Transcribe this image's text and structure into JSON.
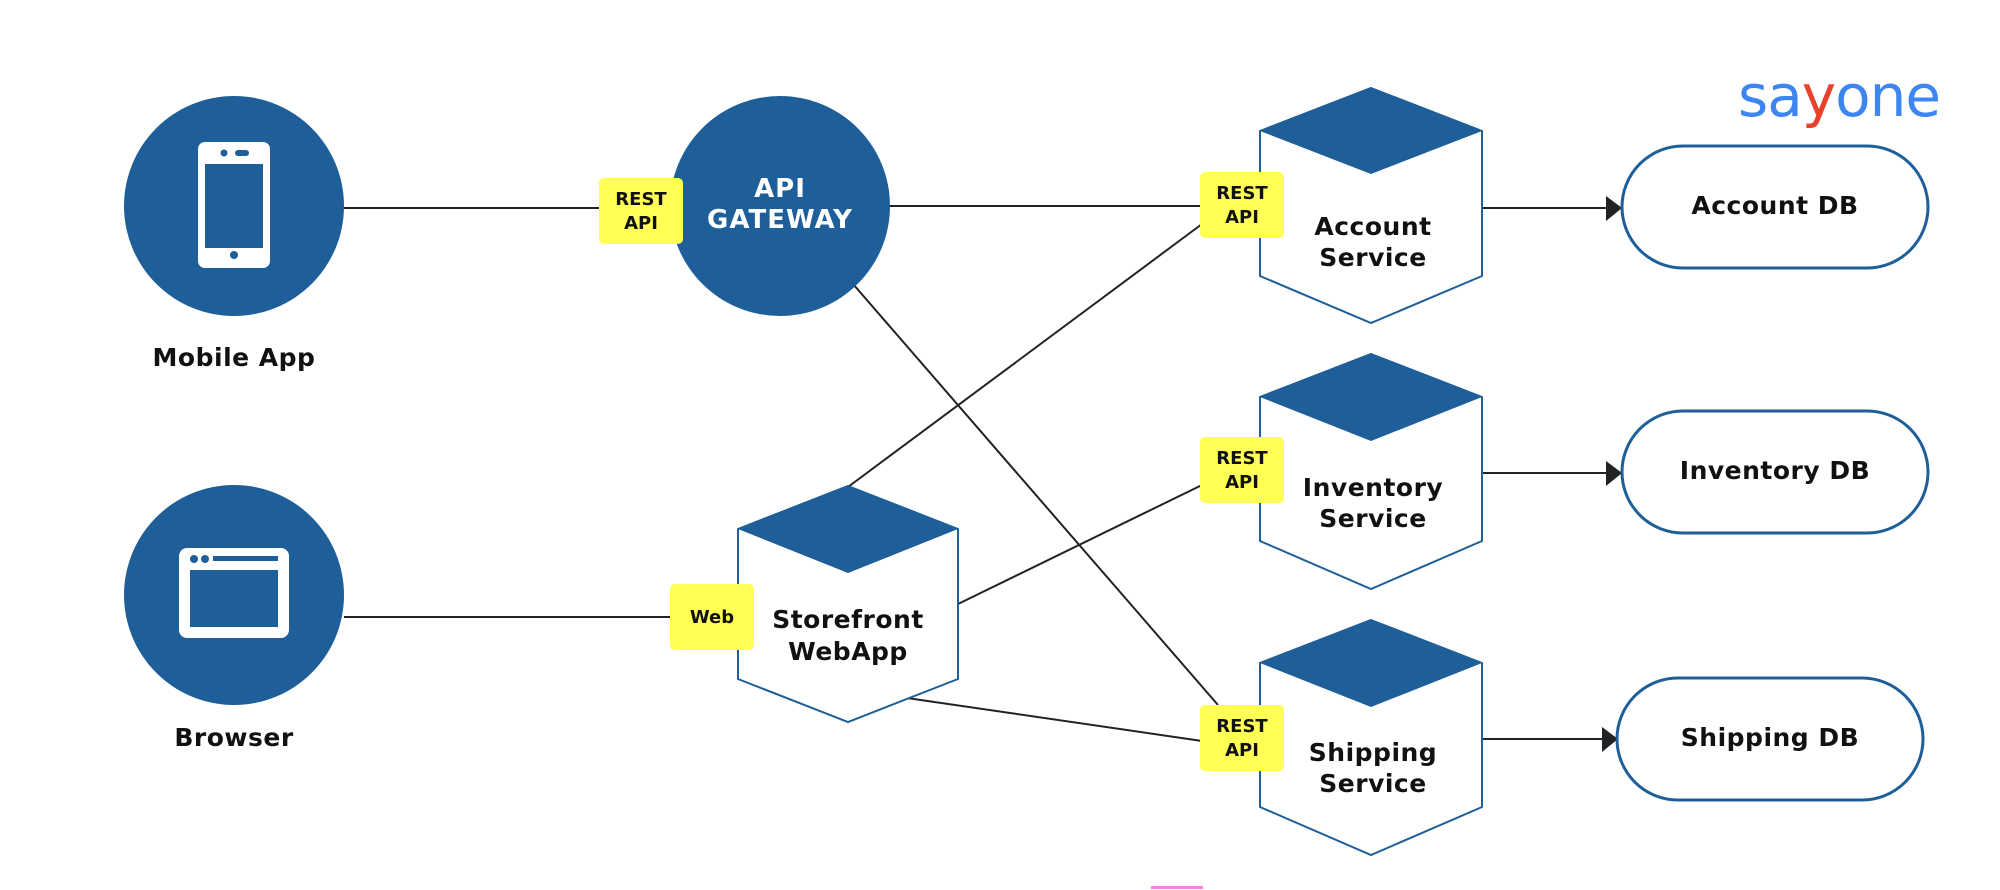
{
  "logo": {
    "pre": "sa",
    "accent": "y",
    "post": "one",
    "primary_color": "#3d86f2",
    "accent_color": "#e8412c"
  },
  "colors": {
    "node_fill": "#1e5e99",
    "badge_fill": "#ffff55",
    "line": "#222222"
  },
  "clients": [
    {
      "id": "mobile",
      "label": "Mobile App",
      "icon": "smartphone-icon"
    },
    {
      "id": "browser",
      "label": "Browser",
      "icon": "browser-window-icon"
    }
  ],
  "gateway": {
    "line1": "API",
    "line2": "GATEWAY"
  },
  "storefront": {
    "line1": "Storefront",
    "line2": "WebApp"
  },
  "services": [
    {
      "id": "account",
      "line1": "Account",
      "line2": "Service",
      "db": "Account DB"
    },
    {
      "id": "inventory",
      "line1": "Inventory",
      "line2": "Service",
      "db": "Inventory DB"
    },
    {
      "id": "shipping",
      "line1": "Shipping",
      "line2": "Service",
      "db": "Shipping DB"
    }
  ],
  "badges": {
    "rest_line1": "REST",
    "rest_line2": "API",
    "web": "Web"
  }
}
